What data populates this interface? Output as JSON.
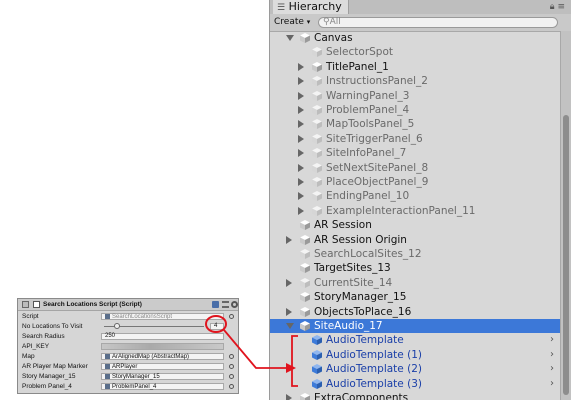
{
  "inspector": {
    "title": "Search Locations Script (Script)",
    "rows": [
      {
        "label": "Script",
        "value": "SearchLocationsScript",
        "kind": "object"
      },
      {
        "label": "No Locations To Visit",
        "value": "4",
        "kind": "slider",
        "slider_fraction": 0.1
      },
      {
        "label": "Search Radius",
        "value": "250",
        "kind": "text"
      },
      {
        "label": "API_KEY",
        "value": "",
        "kind": "blurred"
      },
      {
        "label": "Map",
        "value": "ArAlignedMap (AbstractMap)",
        "kind": "object"
      },
      {
        "label": "AR Player Map Marker",
        "value": "ARPlayer",
        "kind": "object"
      },
      {
        "label": "Story Manager_15",
        "value": "StoryManager_15",
        "kind": "object"
      },
      {
        "label": "Problem Panel_4",
        "value": "ProblemPanel_4",
        "kind": "object"
      }
    ]
  },
  "hierarchy": {
    "tab_label": "Hierarchy",
    "create_label": "Create",
    "search_placeholder": "All",
    "items": [
      {
        "label": "Canvas",
        "indent": 1,
        "arrow": "down",
        "state": "normal"
      },
      {
        "label": "SelectorSpot",
        "indent": 2,
        "arrow": "none",
        "state": "disabled"
      },
      {
        "label": "TitlePanel_1",
        "indent": 2,
        "arrow": "right",
        "state": "normal"
      },
      {
        "label": "InstructionsPanel_2",
        "indent": 2,
        "arrow": "right",
        "state": "disabled"
      },
      {
        "label": "WarningPanel_3",
        "indent": 2,
        "arrow": "right",
        "state": "disabled"
      },
      {
        "label": "ProblemPanel_4",
        "indent": 2,
        "arrow": "right",
        "state": "disabled"
      },
      {
        "label": "MapToolsPanel_5",
        "indent": 2,
        "arrow": "right",
        "state": "disabled"
      },
      {
        "label": "SiteTriggerPanel_6",
        "indent": 2,
        "arrow": "right",
        "state": "disabled"
      },
      {
        "label": "SiteInfoPanel_7",
        "indent": 2,
        "arrow": "right",
        "state": "disabled"
      },
      {
        "label": "SetNextSitePanel_8",
        "indent": 2,
        "arrow": "right",
        "state": "disabled"
      },
      {
        "label": "PlaceObjectPanel_9",
        "indent": 2,
        "arrow": "right",
        "state": "disabled"
      },
      {
        "label": "EndingPanel_10",
        "indent": 2,
        "arrow": "right",
        "state": "disabled"
      },
      {
        "label": "ExampleInteractionPanel_11",
        "indent": 2,
        "arrow": "right",
        "state": "disabled"
      },
      {
        "label": "AR Session",
        "indent": 1,
        "arrow": "none",
        "state": "normal"
      },
      {
        "label": "AR Session Origin",
        "indent": 1,
        "arrow": "right",
        "state": "normal"
      },
      {
        "label": "SearchLocalSites_12",
        "indent": 1,
        "arrow": "none",
        "state": "disabled"
      },
      {
        "label": "TargetSites_13",
        "indent": 1,
        "arrow": "none",
        "state": "normal"
      },
      {
        "label": "CurrentSite_14",
        "indent": 1,
        "arrow": "right",
        "state": "disabled"
      },
      {
        "label": "StoryManager_15",
        "indent": 1,
        "arrow": "none",
        "state": "normal"
      },
      {
        "label": "ObjectsToPlace_16",
        "indent": 1,
        "arrow": "right",
        "state": "normal"
      },
      {
        "label": "SiteAudio_17",
        "indent": 1,
        "arrow": "down",
        "state": "selected"
      },
      {
        "label": "AudioTemplate",
        "indent": 2,
        "arrow": "none",
        "state": "prefab"
      },
      {
        "label": "AudioTemplate (1)",
        "indent": 2,
        "arrow": "none",
        "state": "prefab"
      },
      {
        "label": "AudioTemplate (2)",
        "indent": 2,
        "arrow": "none",
        "state": "prefab"
      },
      {
        "label": "AudioTemplate (3)",
        "indent": 2,
        "arrow": "none",
        "state": "prefab"
      },
      {
        "label": "ExtraComponents",
        "indent": 1,
        "arrow": "right",
        "state": "normal"
      }
    ]
  },
  "colors": {
    "selection": "#3c78d8",
    "prefab_text": "#1a3fa8",
    "annotation": "#e0141e"
  },
  "icons": {
    "tab": "hierarchy-list-icon",
    "lock": "lock-icon",
    "menu": "menu-icon",
    "object": "cube-icon"
  }
}
